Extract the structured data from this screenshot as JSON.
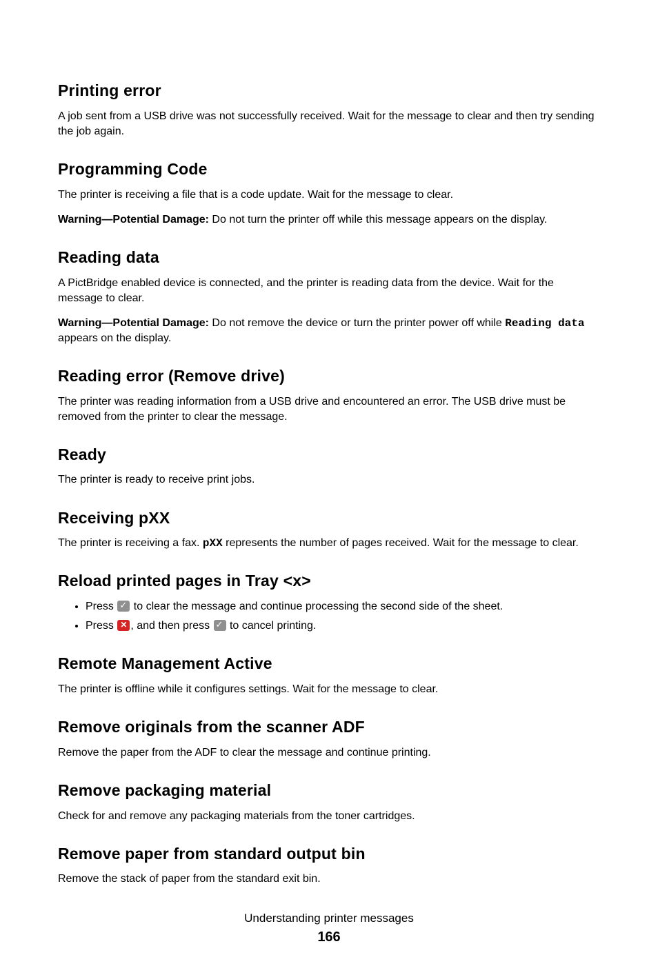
{
  "sections": [
    {
      "heading": "Printing error",
      "body": "A job sent from a USB drive was not successfully received. Wait for the message to clear and then try sending the job again."
    },
    {
      "heading": "Programming Code",
      "body": "The printer is receiving a file that is a code update. Wait for the message to clear.",
      "warning_label": "Warning—Potential Damage:",
      "warning_text": " Do not turn the printer off while this message appears on the display."
    },
    {
      "heading": "Reading data",
      "body": "A PictBridge enabled device is connected, and the printer is reading data from the device. Wait for the message to clear.",
      "warning_label": "Warning—Potential Damage:",
      "warning_pre": " Do not remove the device or turn the printer power off while ",
      "warning_code": "Reading data",
      "warning_post": " appears on the display."
    },
    {
      "heading": "Reading error (Remove drive)",
      "body": "The printer was reading information from a USB drive and encountered an error. The USB drive must be removed from the printer to clear the message."
    },
    {
      "heading": "Ready",
      "body": "The printer is ready to receive print jobs."
    },
    {
      "heading": "Receiving pXX",
      "body_pre": "The printer is receiving a fax. ",
      "body_code": "pXX",
      "body_post": " represents the number of pages received. Wait for the message to clear."
    },
    {
      "heading": "Reload printed pages in Tray <x>",
      "bullets": [
        {
          "pre": "Press ",
          "btn1": "check",
          "post1": " to clear the message and continue processing the second side of the sheet."
        },
        {
          "pre": "Press ",
          "btn1": "x",
          "mid": ", and then press ",
          "btn2": "check",
          "post2": " to cancel printing."
        }
      ]
    },
    {
      "heading": "Remote Management Active",
      "body": "The printer is offline while it configures settings. Wait for the message to clear."
    },
    {
      "heading": "Remove originals from the scanner ADF",
      "body": "Remove the paper from the ADF to clear the message and continue printing."
    },
    {
      "heading": "Remove packaging material",
      "body": "Check for and remove any packaging materials from the toner cartridges."
    },
    {
      "heading": "Remove paper from standard output bin",
      "body": "Remove the stack of paper from the standard exit bin."
    }
  ],
  "footer": {
    "title": "Understanding printer messages",
    "page": "166"
  }
}
